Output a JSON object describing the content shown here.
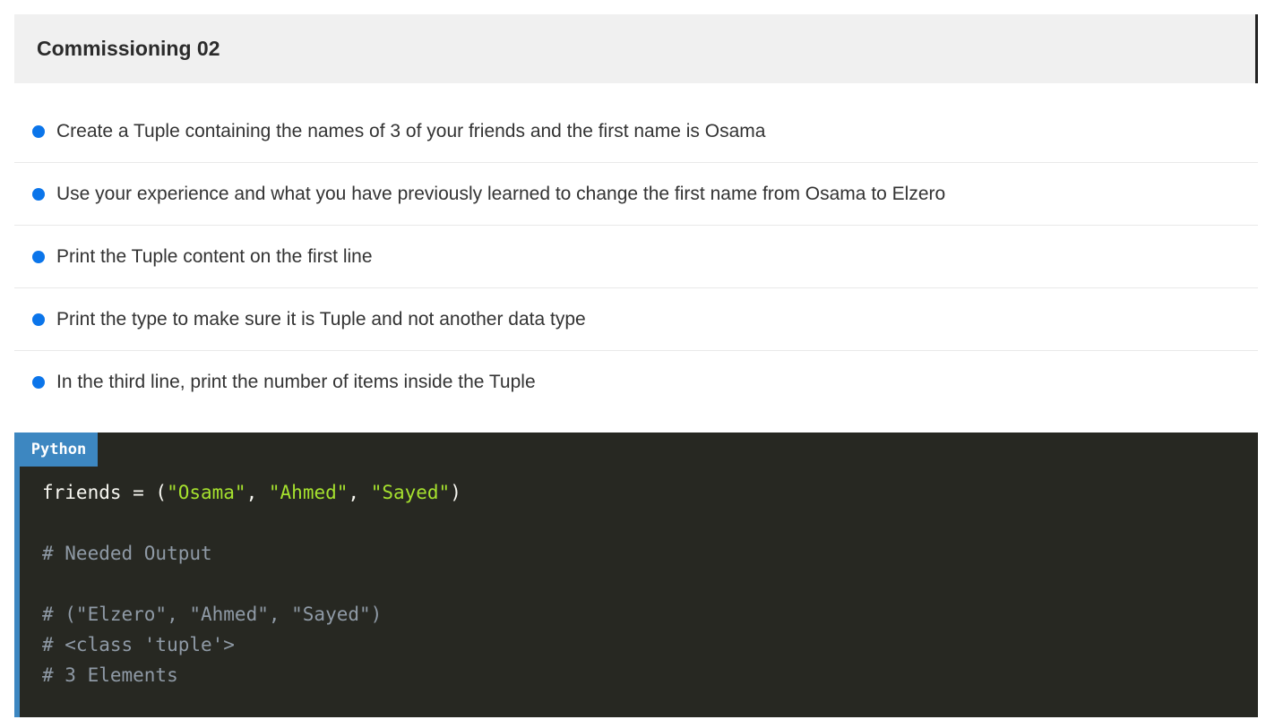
{
  "header": {
    "title": "Commissioning 02"
  },
  "tasks": [
    "Create a Tuple containing the names of 3 of your friends and the first name is Osama",
    "Use your experience and what you have previously learned to change the first name from Osama to Elzero",
    "Print the Tuple content on the first line",
    "Print the type to make sure it is Tuple and not another data type",
    "In the third line, print the number of items inside the Tuple"
  ],
  "code_block": {
    "language": "Python",
    "line1": {
      "var": "friends = (",
      "str1": "\"Osama\"",
      "sep1": ", ",
      "str2": "\"Ahmed\"",
      "sep2": ", ",
      "str3": "\"Sayed\"",
      "close": ")"
    },
    "comment_heading": "# Needed Output",
    "comments": [
      "# (\"Elzero\", \"Ahmed\", \"Sayed\")",
      "# <class 'tuple'>",
      "# 3 Elements"
    ]
  },
  "colors": {
    "bullet": "#0b75ea",
    "code_background": "#272822",
    "lang_tag": "#3d87c1",
    "string": "#a6e22e",
    "comment": "#8f9aa6"
  }
}
